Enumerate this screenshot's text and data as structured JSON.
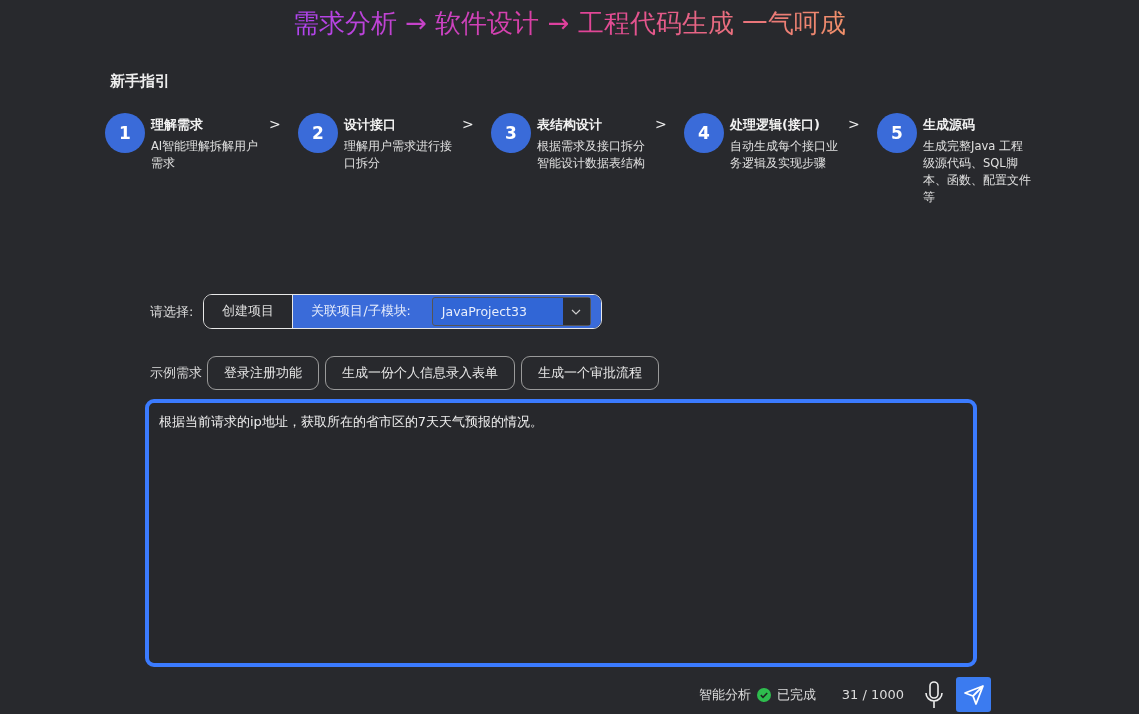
{
  "title": "需求分析 → 软件设计 → 工程代码生成 一气呵成",
  "guide": {
    "heading": "新手指引",
    "steps": [
      {
        "number": "1",
        "title": "理解需求",
        "description": "AI智能理解拆解用户需求",
        "separator": ">"
      },
      {
        "number": "2",
        "title": "设计接口",
        "description": "理解用户需求进行接口拆分",
        "separator": ">"
      },
      {
        "number": "3",
        "title": "表结构设计",
        "description": "根据需求及接口拆分智能设计数据表结构",
        "separator": ">"
      },
      {
        "number": "4",
        "title": "处理逻辑(接口)",
        "description": "自动生成每个接口业务逻辑及实现步骤",
        "separator": ">"
      },
      {
        "number": "5",
        "title": "生成源码",
        "description": "生成完整Java 工程级源代码、SQL脚本、函数、配置文件等"
      }
    ]
  },
  "selector": {
    "label": "请选择:",
    "options": [
      {
        "label": "创建项目",
        "selected": false
      },
      {
        "label": "关联项目/子模块:",
        "selected": true
      }
    ],
    "project_dropdown": {
      "value": "JavaProject33"
    }
  },
  "examples": {
    "label": "示例需求",
    "chips": [
      "登录注册功能",
      "生成一份个人信息录入表单",
      "生成一个审批流程"
    ]
  },
  "prompt": {
    "value": "根据当前请求的ip地址，获取所在的省市区的7天天气预报的情况。"
  },
  "status": {
    "analysis_label": "智能分析",
    "done": true,
    "done_label": "已完成",
    "counter": "31 / 1000"
  }
}
